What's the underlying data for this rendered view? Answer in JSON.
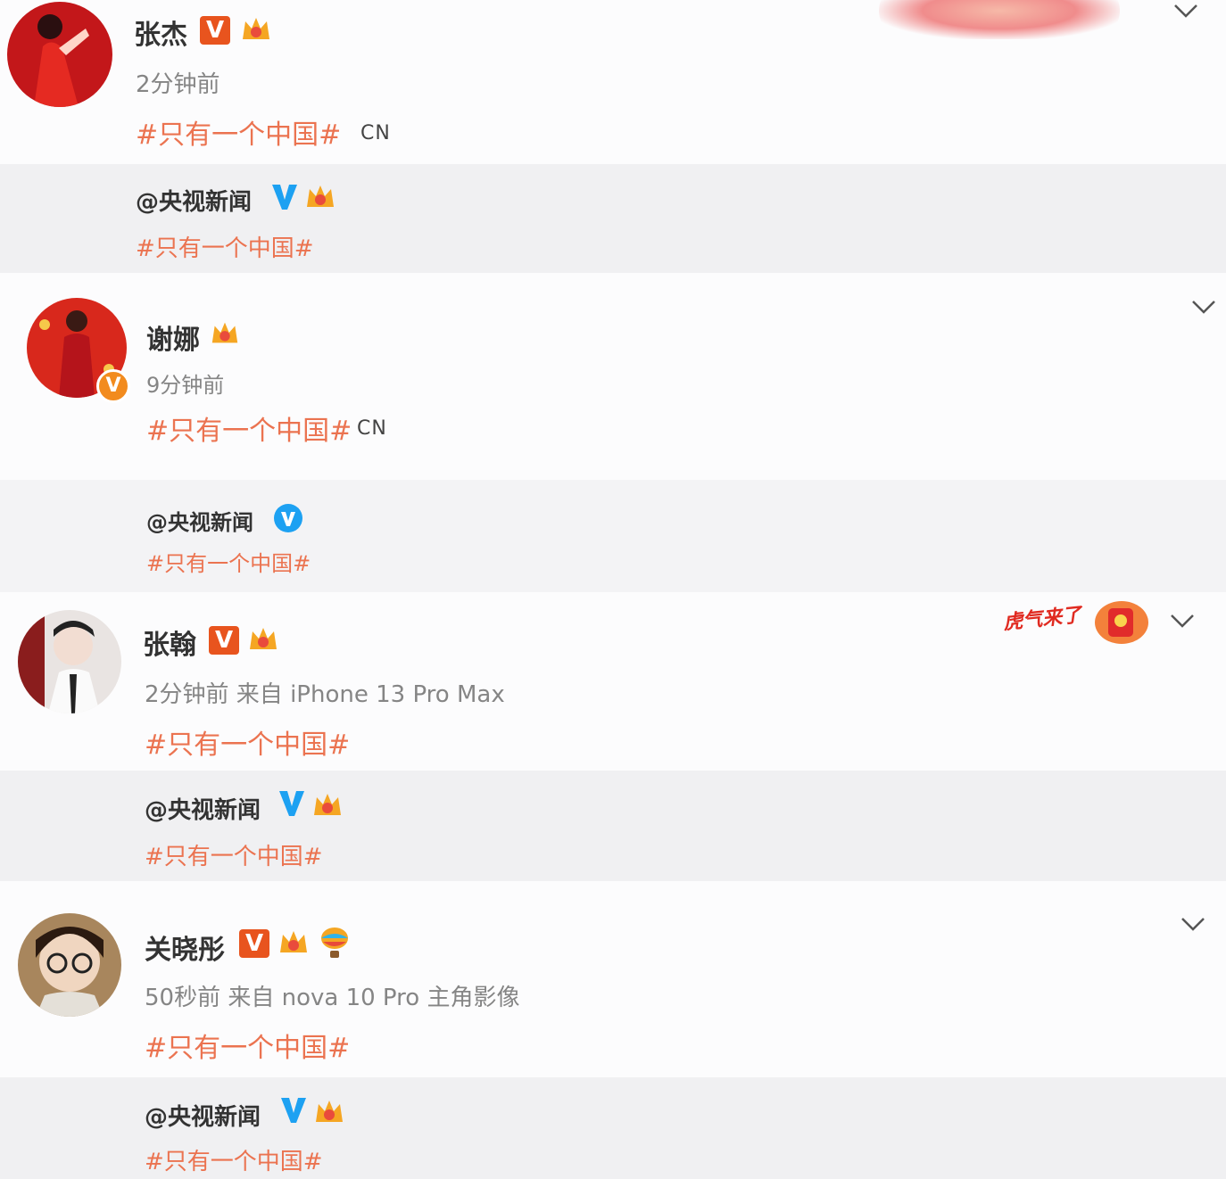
{
  "posts": [
    {
      "name": "张杰",
      "time": "2分钟前",
      "tag": "#只有一个中国#",
      "suffix": "CN",
      "repost": {
        "name": "@央视新闻",
        "tag": "#只有一个中国#"
      }
    },
    {
      "name": "谢娜",
      "time": "9分钟前",
      "tag": "#只有一个中国#",
      "suffix": "CN",
      "repost": {
        "name": "@央视新闻",
        "tag": "#只有一个中国#"
      }
    },
    {
      "name": "张翰",
      "time": "2分钟前 来自 iPhone 13 Pro Max",
      "tag": "#只有一个中国#",
      "sticker": "虎气来了",
      "repost": {
        "name": "@央视新闻",
        "tag": "#只有一个中国#"
      }
    },
    {
      "name": "关晓彤",
      "time": "50秒前 来自 nova 10 Pro 主角影像",
      "tag": "#只有一个中国#",
      "repost": {
        "name": "@央视新闻",
        "tag": "#只有一个中国#"
      }
    }
  ],
  "icons": {
    "verified": "orange-v-badge",
    "repost_verified": "blue-v-icon",
    "crown": "crown-icon",
    "menu": "chevron-down-icon"
  },
  "colors": {
    "tag": "#eb7350",
    "verified_orange": "#e8541e",
    "verified_blue": "#1da1f2",
    "repost_bg": "#f0f0f2"
  }
}
